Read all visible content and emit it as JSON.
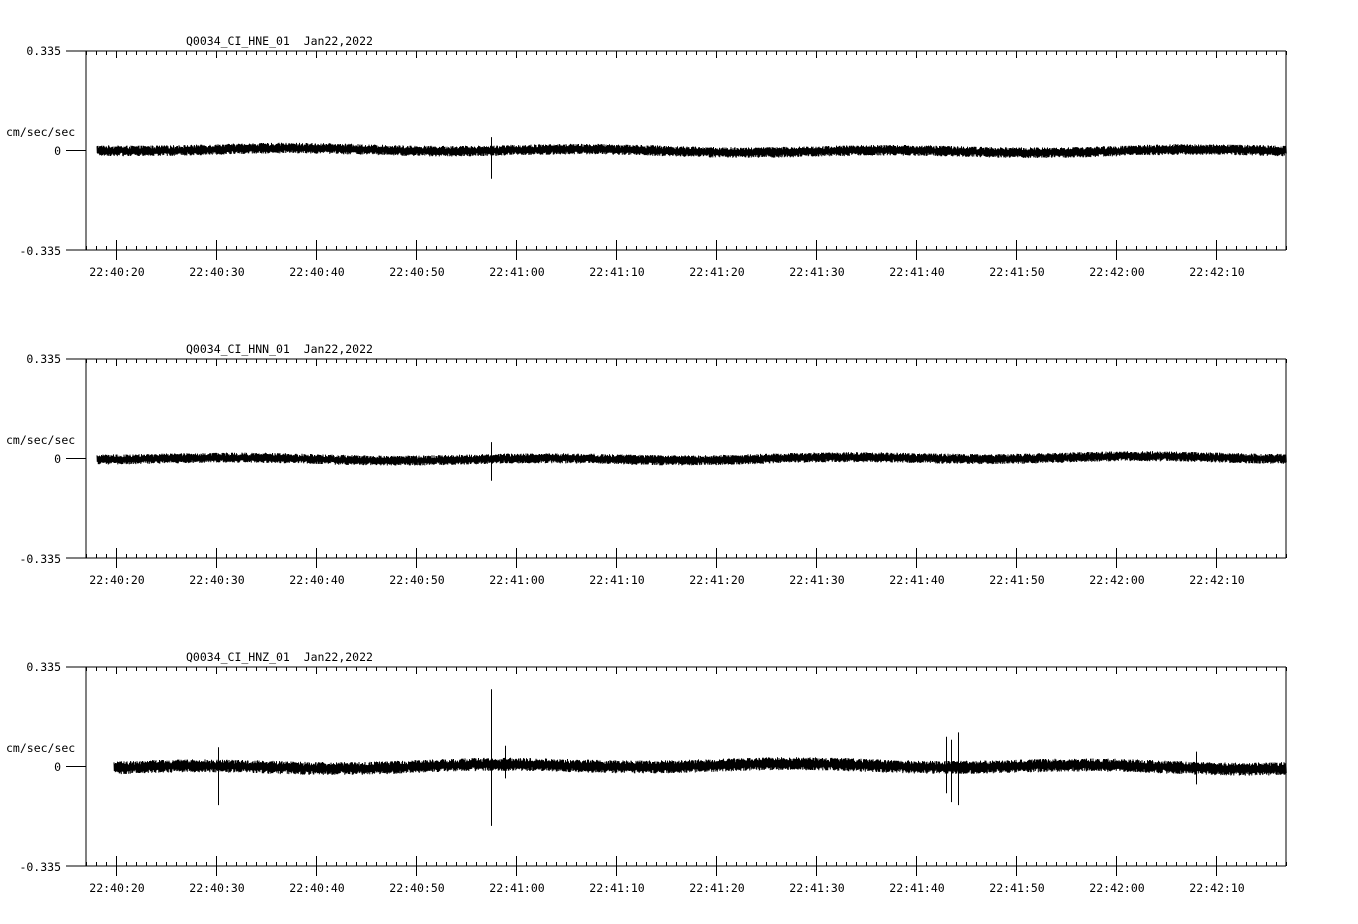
{
  "chart_data": [
    {
      "type": "line",
      "title": "Q0034_CI_HNE_01  Jan22,2022",
      "ylabel": "cm/sec/sec",
      "ylim": [
        -0.335,
        0.335
      ],
      "ytick_labels": [
        "0.335",
        "0",
        "-0.335"
      ],
      "xlim_seconds_after_22_40_00": [
        17.0,
        137.0
      ],
      "xtick_labels": [
        "22:40:20",
        "22:40:30",
        "22:40:40",
        "22:40:50",
        "22:41:00",
        "22:41:10",
        "22:41:20",
        "22:41:30",
        "22:41:40",
        "22:41:50",
        "22:42:00",
        "22:42:10"
      ],
      "series": [
        {
          "trace_start_time": "22:40:18.1",
          "noise_amplitude": 0.018,
          "events": [
            {
              "time": "22:40:57.5",
              "max": 0.045,
              "min": -0.095
            }
          ]
        }
      ],
      "grid": false
    },
    {
      "type": "line",
      "title": "Q0034_CI_HNN_01  Jan22,2022",
      "ylabel": "cm/sec/sec",
      "ylim": [
        -0.335,
        0.335
      ],
      "ytick_labels": [
        "0.335",
        "0",
        "-0.335"
      ],
      "xlim_seconds_after_22_40_00": [
        17.0,
        137.0
      ],
      "xtick_labels": [
        "22:40:20",
        "22:40:30",
        "22:40:40",
        "22:40:50",
        "22:41:00",
        "22:41:10",
        "22:41:20",
        "22:41:30",
        "22:41:40",
        "22:41:50",
        "22:42:00",
        "22:42:10"
      ],
      "series": [
        {
          "trace_start_time": "22:40:18.1",
          "noise_amplitude": 0.017,
          "events": [
            {
              "time": "22:40:57.5",
              "max": 0.055,
              "min": -0.075
            }
          ]
        }
      ],
      "grid": false
    },
    {
      "type": "line",
      "title": "Q0034_CI_HNZ_01  Jan22,2022",
      "ylabel": "cm/sec/sec",
      "ylim": [
        -0.335,
        0.335
      ],
      "ytick_labels": [
        "0.335",
        "0",
        "-0.335"
      ],
      "xlim_seconds_after_22_40_00": [
        17.0,
        137.0
      ],
      "xtick_labels": [
        "22:40:20",
        "22:40:30",
        "22:40:40",
        "22:40:50",
        "22:41:00",
        "22:41:10",
        "22:41:20",
        "22:41:30",
        "22:41:40",
        "22:41:50",
        "22:42:00",
        "22:42:10"
      ],
      "series": [
        {
          "trace_start_time": "22:40:19.8",
          "noise_amplitude": 0.022,
          "events": [
            {
              "time": "22:40:30.2",
              "max": 0.065,
              "min": -0.13
            },
            {
              "time": "22:40:57.5",
              "max": 0.26,
              "min": -0.2
            },
            {
              "time": "22:40:58.9",
              "max": 0.07,
              "min": -0.04
            },
            {
              "time": "22:41:43.0",
              "max": 0.1,
              "min": -0.09
            },
            {
              "time": "22:41:43.5",
              "max": 0.09,
              "min": -0.12
            },
            {
              "time": "22:41:44.2",
              "max": 0.115,
              "min": -0.13
            },
            {
              "time": "22:42:08.0",
              "max": 0.05,
              "min": -0.06
            }
          ]
        }
      ],
      "grid": false
    }
  ]
}
